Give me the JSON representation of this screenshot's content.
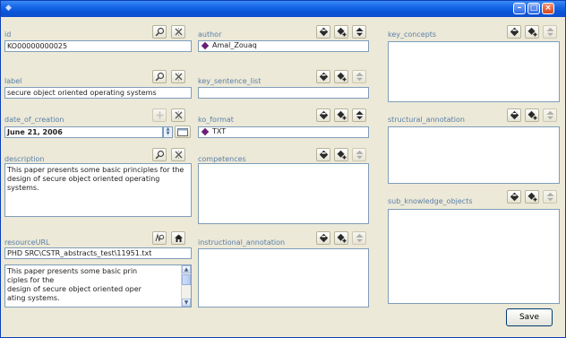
{
  "window": {
    "title": "",
    "controls": {
      "minimize": "–",
      "maximize": "□",
      "close": "×"
    }
  },
  "col1": {
    "id": {
      "label": "id",
      "value": "KO00000000025"
    },
    "label": {
      "label": "label",
      "value": "secure object oriented operating systems"
    },
    "date": {
      "label": "date_of_creation",
      "value": "June 21, 2006"
    },
    "description": {
      "label": "description",
      "text": "This paper presents some basic principles for the design of secure object oriented operating systems."
    },
    "resource": {
      "label": "resourceURL",
      "value": "PHD SRC\\CSTR_abstracts_test\\11951.txt",
      "preview": [
        "This paper presents some basic prin",
        "ciples for the",
        "design of secure object oriented oper",
        "ating systems."
      ]
    }
  },
  "col2": {
    "author": {
      "label": "author",
      "items": [
        "Amal_Zouaq"
      ]
    },
    "key_sentence_list": {
      "label": "key_sentence_list"
    },
    "ko_format": {
      "label": "ko_format",
      "items": [
        "TXT"
      ]
    },
    "competences": {
      "label": "competences"
    },
    "instructional_annotation": {
      "label": "instructional_annotation"
    }
  },
  "col3": {
    "key_concepts": {
      "label": "key_concepts"
    },
    "structural_annotation": {
      "label": "structural_annotation"
    },
    "sub_knowledge_objects": {
      "label": "sub_knowledge_objects"
    }
  },
  "buttons": {
    "save": "Save"
  },
  "icons": {
    "search": "search-icon",
    "clear": "clear-icon",
    "edit": "edit-icon",
    "add": "add-icon",
    "remove": "remove-icon",
    "calendar": "calendar-icon",
    "resource_search": "resource-search-icon",
    "home": "home-icon"
  },
  "colors": {
    "label": "#5b7fa6",
    "item": "#6a1f74",
    "titlebar": "#0a55d8"
  }
}
